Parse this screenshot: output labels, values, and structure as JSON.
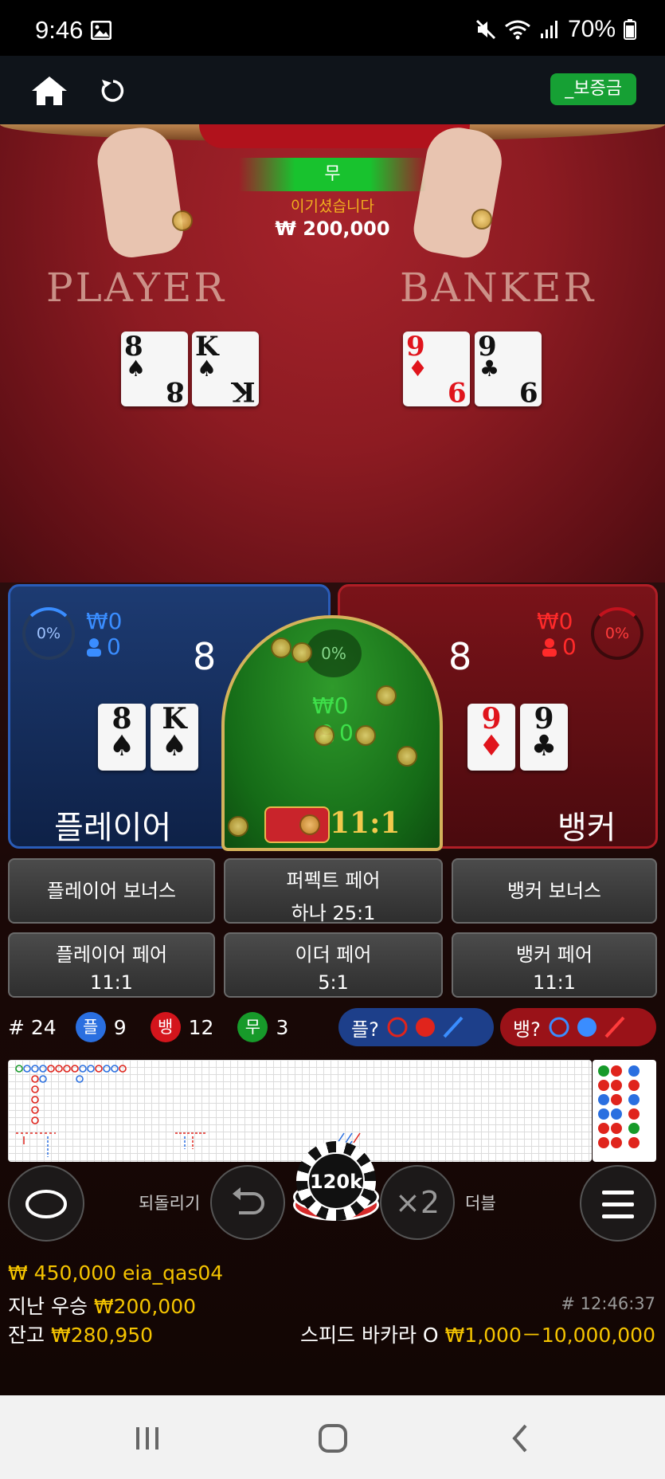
{
  "status_bar": {
    "time": "9:46",
    "battery": "70%"
  },
  "header": {
    "deposit_button": "_보증금"
  },
  "table": {
    "tie_label": "무",
    "win_text": "이기셨습니다",
    "win_amount": "₩ 200,000",
    "player_label": "PLAYER",
    "banker_label": "BANKER",
    "player_cards": [
      {
        "rank": "8",
        "suit": "♠",
        "color": "black"
      },
      {
        "rank": "K",
        "suit": "♠",
        "color": "black"
      }
    ],
    "banker_cards": [
      {
        "rank": "9",
        "suit": "♦",
        "color": "red"
      },
      {
        "rank": "9",
        "suit": "♣",
        "color": "black"
      }
    ]
  },
  "player": {
    "percent": "0%",
    "bet_amount": "₩0",
    "players": "0",
    "score": "8",
    "label": "플레이어"
  },
  "tie": {
    "percent": "0%",
    "bet_amount": "₩0",
    "players": "0",
    "odds": "11:1"
  },
  "banker": {
    "percent": "0%",
    "bet_amount": "₩0",
    "players": "0",
    "score": "8",
    "label": "뱅커"
  },
  "side_bets": {
    "player_bonus": "플레이어 보너스",
    "perfect_pair": "퍼펙트 페어",
    "perfect_pair_odds": "하나 25:1",
    "banker_bonus": "뱅커 보너스",
    "player_pair": "플레이어 페어",
    "player_pair_odds": "11:1",
    "either_pair": "이더 페어",
    "either_pair_odds": "5:1",
    "banker_pair": "뱅커 페어",
    "banker_pair_odds": "11:1"
  },
  "stats": {
    "rounds": "# 24",
    "player_badge": "플",
    "player_wins": "9",
    "banker_badge": "뱅",
    "banker_wins": "12",
    "tie_badge": "무",
    "ties": "3",
    "player_predict": "플?",
    "banker_predict": "뱅?"
  },
  "controls": {
    "undo_label": "되돌리기",
    "chip_value": "120k",
    "double_symbol": "×2",
    "double_label": "더블"
  },
  "info": {
    "balance_user": "₩ 450,000 eia_qas04",
    "last_win_label": "지난 우승",
    "last_win": "₩200,000",
    "balance_label": "잔고",
    "balance": "₩280,950",
    "round_id": "# 12:46:37",
    "table_name": "스피드 바카라 O",
    "limits": "₩1,000－10,000,000"
  },
  "colors": {
    "player_blue": "#1d3b72",
    "banker_red": "#7a1319",
    "tie_green": "#1a7a1c",
    "gold": "#f5c400",
    "deposit_green": "#16a034"
  }
}
